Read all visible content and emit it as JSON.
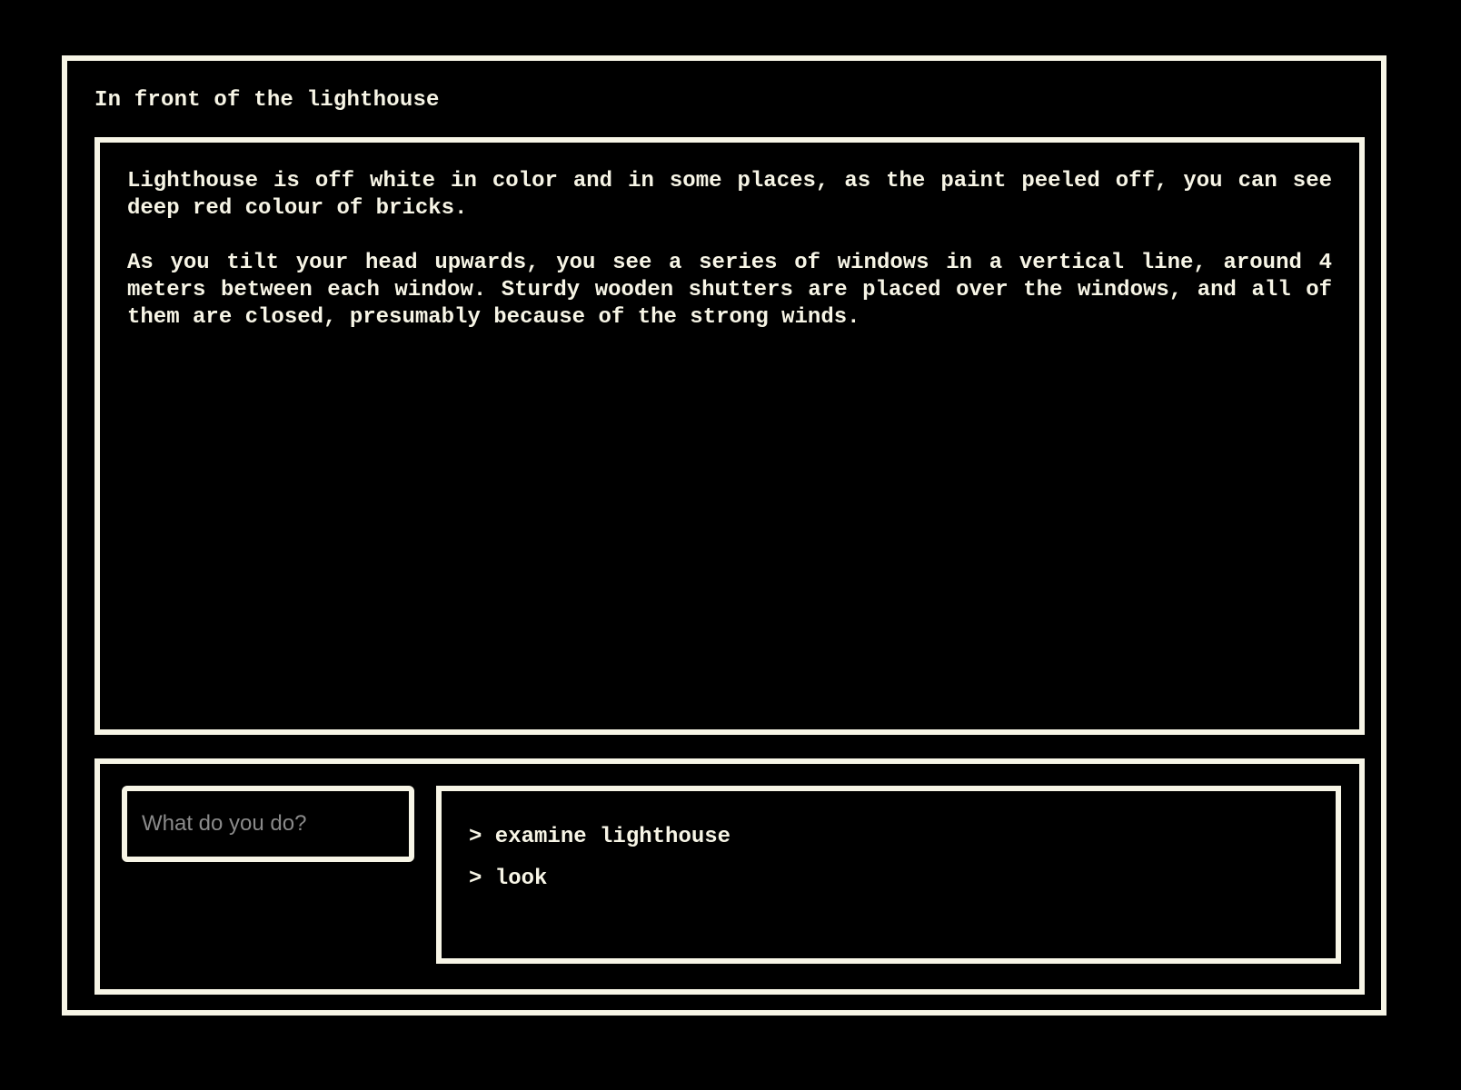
{
  "location": {
    "title": "In front of the lighthouse"
  },
  "narrative": {
    "paragraphs": [
      "Lighthouse is off white in color and in some places, as the paint peeled off, you can see deep red colour of bricks.",
      "As you tilt your head upwards, you see a series of windows in a vertical line, around 4 meters between each window. Sturdy wooden shutters are placed over the windows, and all of them are closed, presumably because of the strong winds."
    ]
  },
  "command": {
    "value": "",
    "placeholder": "What do you do?"
  },
  "history": {
    "items": [
      "> examine lighthouse",
      "> look"
    ]
  },
  "colors": {
    "background": "#000000",
    "foreground": "#f7f5e6",
    "placeholder": "#8a8a8a"
  }
}
